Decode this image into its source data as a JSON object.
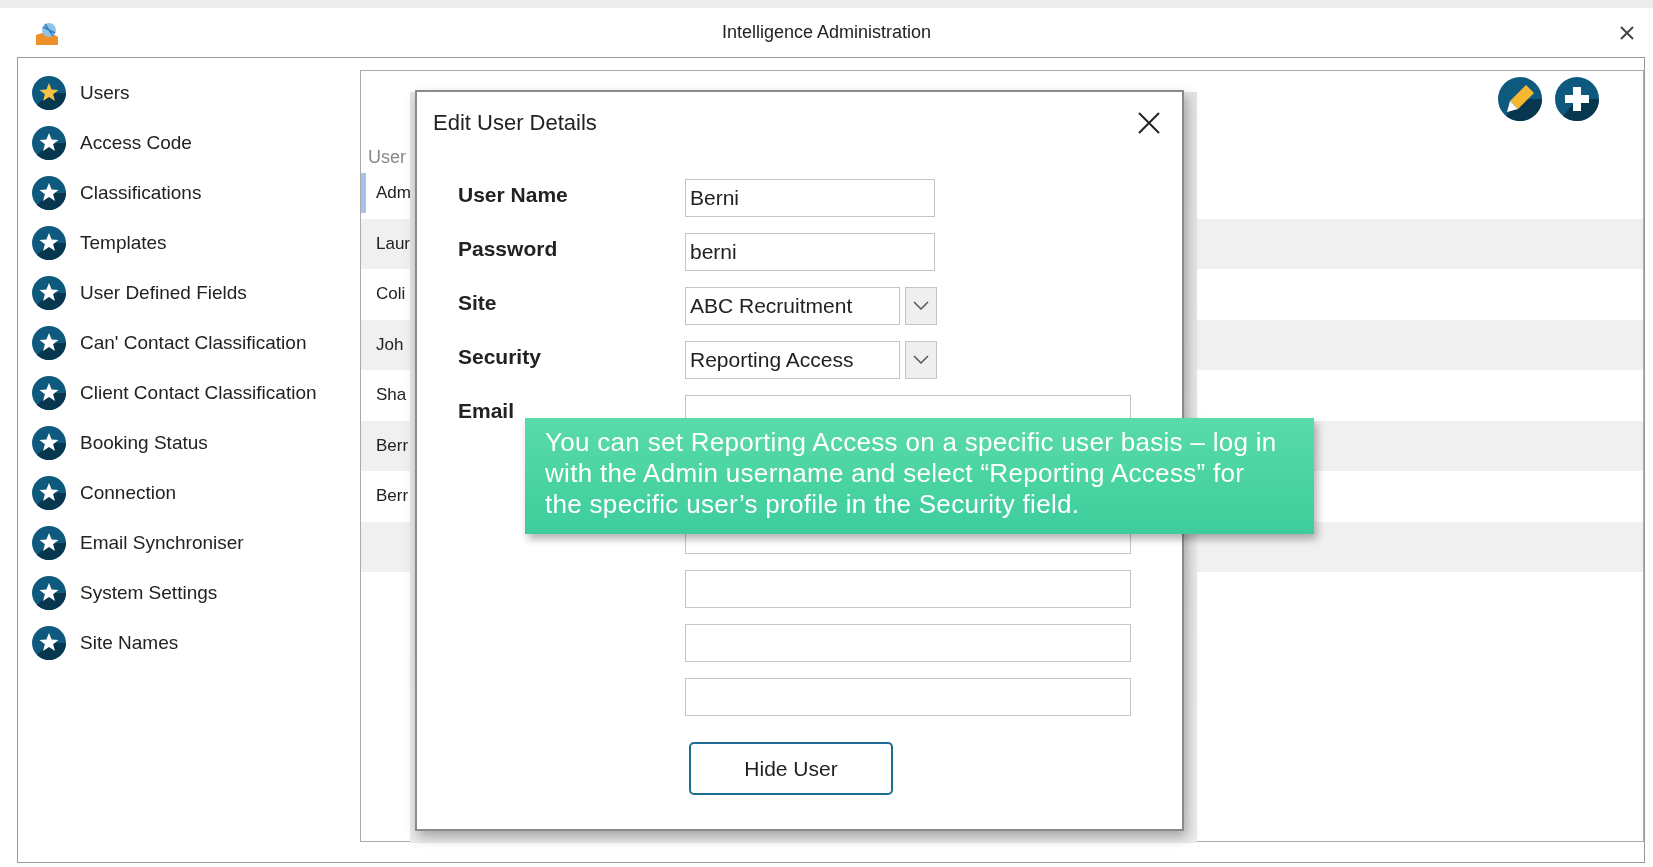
{
  "window": {
    "title": "Intelligence Administration"
  },
  "sidebar": {
    "items": [
      {
        "label": "Users",
        "selected": true
      },
      {
        "label": "Access Code",
        "selected": false
      },
      {
        "label": "Classifications",
        "selected": false
      },
      {
        "label": "Templates",
        "selected": false
      },
      {
        "label": "User Defined Fields",
        "selected": false
      },
      {
        "label": "Can' Contact Classification",
        "selected": false
      },
      {
        "label": "Client Contact Classification",
        "selected": false
      },
      {
        "label": "Booking Status",
        "selected": false
      },
      {
        "label": "Connection",
        "selected": false
      },
      {
        "label": "Email Synchroniser",
        "selected": false
      },
      {
        "label": "System Settings",
        "selected": false
      },
      {
        "label": "Site Names",
        "selected": false
      }
    ]
  },
  "user_list": {
    "header": "User",
    "rows": [
      {
        "text": "Adm",
        "selected": true
      },
      {
        "text": "Laur",
        "selected": false
      },
      {
        "text": "Coli",
        "selected": false
      },
      {
        "text": "Joh",
        "selected": false
      },
      {
        "text": "Sha",
        "selected": false
      },
      {
        "text": "Berr",
        "selected": false
      },
      {
        "text": "Berr",
        "selected": false
      }
    ]
  },
  "dialog": {
    "title": "Edit User Details",
    "fields": [
      {
        "kind": "text",
        "label": "User Name",
        "value": "Berni"
      },
      {
        "kind": "text",
        "label": "Password",
        "value": "berni"
      },
      {
        "kind": "select",
        "label": "Site",
        "value": "ABC Recruitment"
      },
      {
        "kind": "select",
        "label": "Security",
        "value": "Reporting Access"
      },
      {
        "kind": "wide",
        "label": "Email"
      },
      {
        "kind": "blank"
      },
      {
        "kind": "blank"
      },
      {
        "kind": "blank"
      },
      {
        "kind": "blank"
      }
    ],
    "button": "Hide User"
  },
  "tooltip": {
    "text": "You can set Reporting Access on a specific user basis – log in with the Admin username and select “Reporting Access” for the specific user’s profile in the Security field."
  }
}
